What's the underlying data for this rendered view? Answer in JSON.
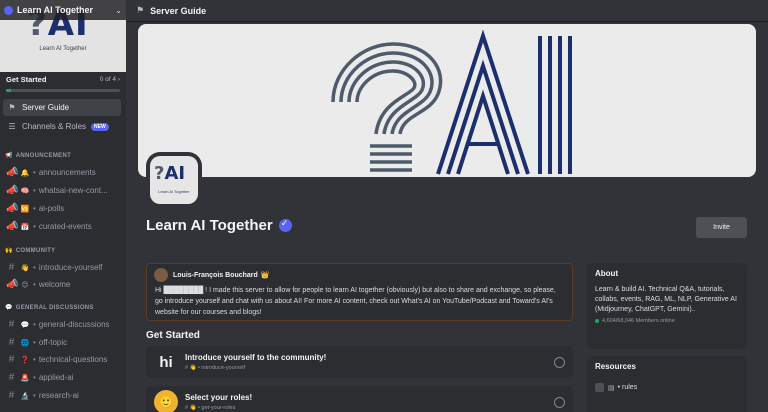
{
  "server": {
    "name": "Learn AI Together",
    "banner_logo": "?AI",
    "banner_subtitle": "Learn AI Together",
    "avatar_logo": "?AI",
    "avatar_subtitle": "Learn AI Together"
  },
  "get_started": {
    "title": "Get Started",
    "count": "0 of 4",
    "progress": 0.04
  },
  "nav": [
    {
      "label": "Server Guide",
      "icon": "signpost-icon",
      "active": true
    },
    {
      "label": "Channels & Roles",
      "icon": "channels-roles-icon",
      "badge": "NEW"
    }
  ],
  "categories": {
    "announcement": {
      "emoji": "📢",
      "label": "ANNOUNCEMENT"
    },
    "community": {
      "emoji": "🙌",
      "label": "COMMUNITY"
    },
    "general": {
      "emoji": "💬",
      "label": "GENERAL DISCUSSIONS"
    }
  },
  "channels": [
    {
      "label": "announcements",
      "emoji": "🔔",
      "icon": "announcement-channel-icon"
    },
    {
      "label": "whatsai-new-cont...",
      "emoji": "🧠",
      "icon": "announcement-channel-icon"
    },
    {
      "label": "ai-polls",
      "emoji": "🆚",
      "icon": "announcement-channel-icon"
    },
    {
      "label": "curated-events",
      "emoji": "📅",
      "icon": "announcement-channel-icon"
    },
    {
      "label": "introduce-yourself",
      "emoji": "👋",
      "icon": "hash-icon"
    },
    {
      "label": "welcome",
      "emoji": "😊",
      "icon": "announcement-channel-icon"
    },
    {
      "label": "general-discussions",
      "emoji": "💬",
      "icon": "hash-icon"
    },
    {
      "label": "off-topic",
      "emoji": "🌐",
      "icon": "hash-icon"
    },
    {
      "label": "technical-questions",
      "emoji": "❓",
      "icon": "hash-icon"
    },
    {
      "label": "applied-ai",
      "emoji": "🚨",
      "icon": "hash-icon"
    },
    {
      "label": "research-ai",
      "emoji": "🔬",
      "icon": "hash-icon"
    }
  ],
  "topbar": {
    "title": "Server Guide",
    "icon": "signpost-icon"
  },
  "hero": {
    "logo_text": "?AI"
  },
  "header": {
    "title": "Learn AI Together",
    "invite_label": "Invite"
  },
  "welcome_message": {
    "author": "Louis-François Bouchard",
    "crown": "👑",
    "body": "Hi ████████ ! I made this server to allow for people to learn AI together (obviously) but also to share and exchange, so please, go introduce yourself and chat with us about AI! For more AI content, check out What's AI on YouTube/Podcast and Toward's AI's website for our courses and blogs!"
  },
  "get_started_section": {
    "heading": "Get Started",
    "tasks": [
      {
        "icon_text": "hi",
        "title": "Introduce yourself to the community!",
        "channel": "# 👋 • introduce-yourself"
      },
      {
        "icon_text": "🙂",
        "title": "Select your roles!",
        "channel": "# 👋 • get-your-roles"
      }
    ]
  },
  "about": {
    "title": "About",
    "text": "Learn & build AI. Technical Q&A, tutorials, collabs, events, RAG, ML, NLP, Generative AI (Midjourney, ChatGPT, Gemini)..",
    "members": "4,604/68,046 Members online"
  },
  "resources": {
    "title": "Resources",
    "items": [
      {
        "label": "• rules"
      }
    ]
  },
  "colors": {
    "accent": "#5865f2",
    "online": "#23a55a",
    "logo_gray": "#4f5a6b",
    "logo_navy": "#1c2f6d"
  }
}
